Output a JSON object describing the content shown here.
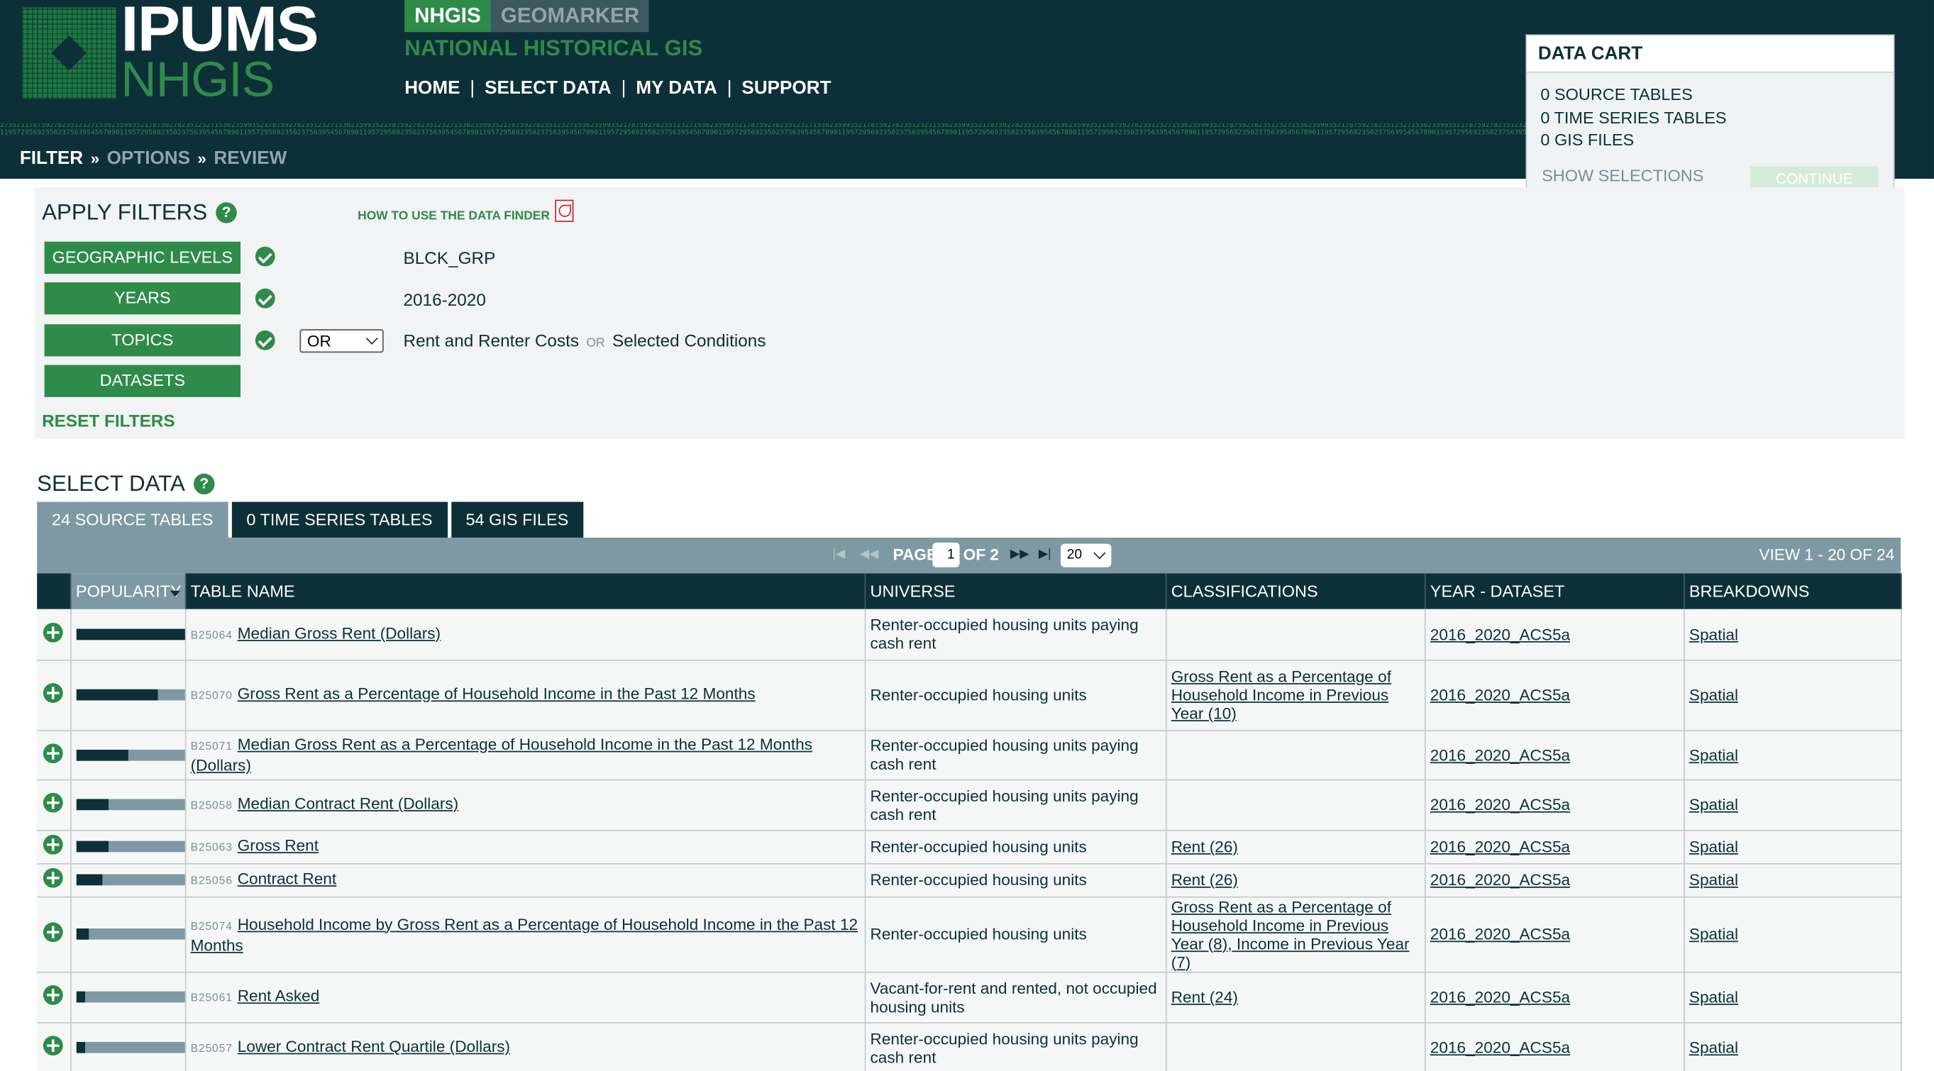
{
  "header": {
    "logo_primary": "IPUMS",
    "logo_secondary": "NHGIS",
    "tab_active": "NHGIS",
    "tab_inactive": "GEOMARKER",
    "subtitle": "NATIONAL HISTORICAL GIS",
    "nav": [
      "HOME",
      "SELECT DATA",
      "MY DATA",
      "SUPPORT"
    ],
    "nav_separator": "|",
    "binary_text": "2735211787592782351232715362359935217875927823512327153623599352178759278235123271536235993521787592782351232715362359935217875927823512327153623599352178759278235123271536235993521787592782351232715362359935217875927823512327153623599352178759278235123271536235993521787592782351232715362359935217875927823512327153623599352178759278235123271536235993521787592782351232715362359935217875927823512327153623599",
    "binary_text_2": "1195729569235023756395456789011957295692350237563954567890119572956923502375639545678901195729569235023756395456789011957295692350237563954567890119572956923502375639545678901195729569235023756395456789011957295692350237563954567890119572956923502375639545678901195729569235023756395456789011957295692350237563954567890119572956923502375639545678901195729569235023756395456789011957295692350",
    "breadcrumb": {
      "current": "FILTER",
      "step2": "OPTIONS",
      "step3": "REVIEW",
      "separator": "»"
    }
  },
  "cart": {
    "title": "DATA CART",
    "source_tables": "0 SOURCE TABLES",
    "time_series_tables": "0 TIME SERIES TABLES",
    "gis_files": "0 GIS FILES",
    "show_selections": "SHOW SELECTIONS",
    "continue": "CONTINUE"
  },
  "filters": {
    "title": "APPLY FILTERS",
    "help": "?",
    "howto": "HOW TO USE THE DATA FINDER",
    "geographic_levels": {
      "label": "GEOGRAPHIC LEVELS",
      "value": "BLCK_GRP"
    },
    "years": {
      "label": "YEARS",
      "value": "2016-2020"
    },
    "topics": {
      "label": "TOPICS",
      "operator": "OR",
      "value1": "Rent and Renter Costs",
      "or_text": "OR",
      "value2": "Selected Conditions"
    },
    "datasets": {
      "label": "DATASETS"
    },
    "reset": "RESET FILTERS"
  },
  "select_data": {
    "title": "SELECT DATA",
    "help": "?",
    "tabs": [
      "24 SOURCE TABLES",
      "0 TIME SERIES TABLES",
      "54 GIS FILES"
    ],
    "pager": {
      "page_label": "PAGE",
      "page": "1",
      "of": "OF 2",
      "page_size": "20",
      "view": "VIEW 1 - 20 OF 24"
    },
    "columns": [
      "POPULARITY",
      "TABLE NAME",
      "UNIVERSE",
      "CLASSIFICATIONS",
      "YEAR - DATASET",
      "BREAKDOWNS"
    ]
  },
  "rows": [
    {
      "popularity": 1.0,
      "code": "B25064",
      "name": "Median Gross Rent (Dollars)",
      "universe": "Renter-occupied housing units paying cash rent",
      "classifications": "",
      "dataset": "2016_2020_ACS5a",
      "breakdowns": "Spatial"
    },
    {
      "popularity": 0.75,
      "code": "B25070",
      "name": "Gross Rent as a Percentage of Household Income in the Past 12 Months",
      "universe": "Renter-occupied housing units",
      "classifications": "Gross Rent as a Percentage of Household Income in Previous Year (10)",
      "dataset": "2016_2020_ACS5a",
      "breakdowns": "Spatial"
    },
    {
      "popularity": 0.48,
      "code": "B25071",
      "name": "Median Gross Rent as a Percentage of Household Income in the Past 12 Months (Dollars)",
      "universe": "Renter-occupied housing units paying cash rent",
      "classifications": "",
      "dataset": "2016_2020_ACS5a",
      "breakdowns": "Spatial"
    },
    {
      "popularity": 0.3,
      "code": "B25058",
      "name": "Median Contract Rent (Dollars)",
      "universe": "Renter-occupied housing units paying cash rent",
      "classifications": "",
      "dataset": "2016_2020_ACS5a",
      "breakdowns": "Spatial"
    },
    {
      "popularity": 0.3,
      "code": "B25063",
      "name": "Gross Rent",
      "universe": "Renter-occupied housing units",
      "classifications": "Rent (26)",
      "dataset": "2016_2020_ACS5a",
      "breakdowns": "Spatial"
    },
    {
      "popularity": 0.24,
      "code": "B25056",
      "name": "Contract Rent",
      "universe": "Renter-occupied housing units",
      "classifications": "Rent (26)",
      "dataset": "2016_2020_ACS5a",
      "breakdowns": "Spatial"
    },
    {
      "popularity": 0.12,
      "code": "B25074",
      "name": "Household Income by Gross Rent as a Percentage of Household Income in the Past 12 Months",
      "universe": "Renter-occupied housing units",
      "classifications": "Gross Rent as a Percentage of Household Income in Previous Year (8), Income in Previous Year (7)",
      "dataset": "2016_2020_ACS5a",
      "breakdowns": "Spatial"
    },
    {
      "popularity": 0.08,
      "code": "B25061",
      "name": "Rent Asked",
      "universe": "Vacant-for-rent and rented, not occupied housing units",
      "classifications": "Rent (24)",
      "dataset": "2016_2020_ACS5a",
      "breakdowns": "Spatial"
    },
    {
      "popularity": 0.08,
      "code": "B25057",
      "name": "Lower Contract Rent Quartile (Dollars)",
      "universe": "Renter-occupied housing units paying cash rent",
      "classifications": "",
      "dataset": "2016_2020_ACS5a",
      "breakdowns": "Spatial"
    }
  ],
  "colors": {
    "brand_dark": "#0d2f38",
    "brand_green": "#2e8b4a",
    "pager_gray": "#7e99a3"
  }
}
